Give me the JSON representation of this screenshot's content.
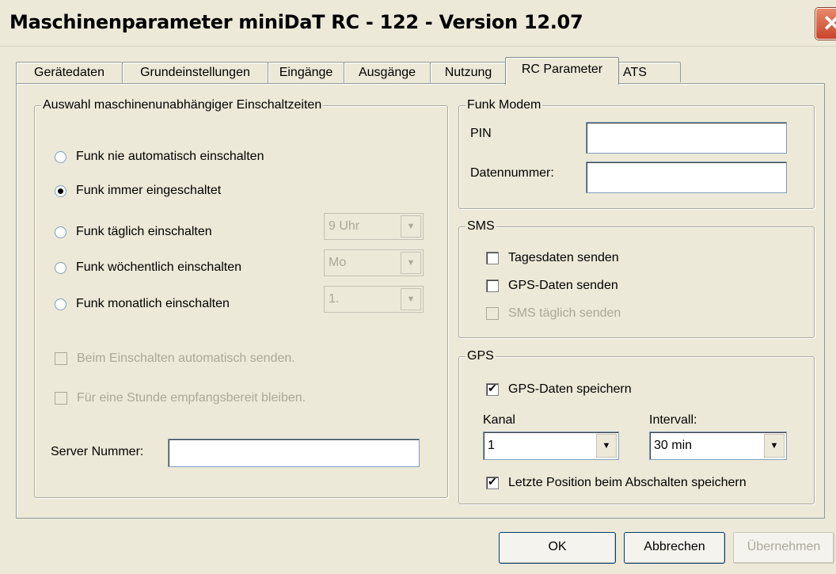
{
  "window": {
    "title": "Maschinenparameter miniDaT RC - 122 - Version 12.07"
  },
  "tabs": [
    "Gerätedaten",
    "Grundeinstellungen",
    "Eingänge",
    "Ausgänge",
    "Nutzung",
    "RC Parameter",
    "ATS"
  ],
  "active_tab": "RC Parameter",
  "left_group": {
    "title": "Auswahl maschinenunabhängiger Einschaltzeiten",
    "radios": [
      {
        "label": "Funk nie automatisch einschalten",
        "checked": false
      },
      {
        "label": "Funk immer eingeschaltet",
        "checked": true
      },
      {
        "label": "Funk täglich einschalten",
        "checked": false,
        "select": "9 Uhr"
      },
      {
        "label": "Funk wöchentlich einschalten",
        "checked": false,
        "select": "Mo"
      },
      {
        "label": "Funk monatlich einschalten",
        "checked": false,
        "select": "1."
      }
    ],
    "checkbox_auto_send": "Beim Einschalten automatisch senden.",
    "checkbox_stay": "Für eine Stunde empfangsbereit bleiben.",
    "server_label": "Server Nummer:",
    "server_value": ""
  },
  "funk_modem": {
    "title": "Funk Modem",
    "pin_label": "PIN",
    "pin_value": "",
    "datennummer_label": "Datennummer:",
    "datennummer_value": ""
  },
  "sms": {
    "title": "SMS",
    "tagesdaten": "Tagesdaten senden",
    "gpsdaten": "GPS-Daten senden",
    "taeglich": "SMS täglich senden"
  },
  "gps": {
    "title": "GPS",
    "speichern": "GPS-Daten speichern",
    "kanal_label": "Kanal",
    "kanal_value": "1",
    "intervall_label": "Intervall:",
    "intervall_value": "30 min",
    "letzte_position": "Letzte Position beim Abschalten speichern"
  },
  "buttons": {
    "ok": "OK",
    "cancel": "Abbrechen",
    "apply": "Übernehmen"
  }
}
